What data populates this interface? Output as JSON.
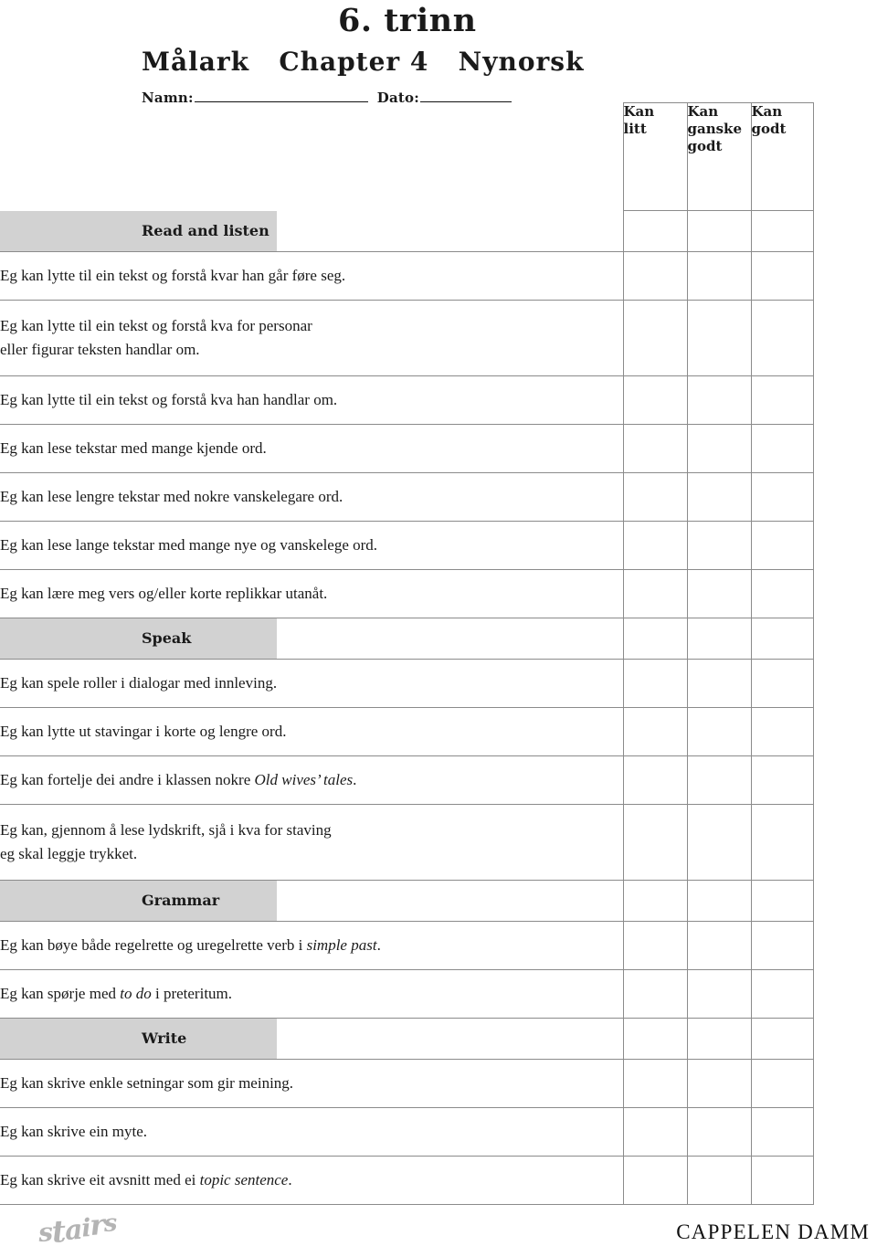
{
  "header": {
    "grade": "6. trinn",
    "title": "Målark   Chapter 4   Nynorsk",
    "name_label": "Namn:",
    "date_label": "Dato:"
  },
  "table": {
    "columns": [
      {
        "id": "statement",
        "label": ""
      },
      {
        "id": "kan_litt",
        "label": "Kan\nlitt"
      },
      {
        "id": "kan_ganske_godt",
        "label": "Kan\nganske\ngodt"
      },
      {
        "id": "kan_godt",
        "label": "Kan\ngodt"
      }
    ],
    "column_labels": {
      "kan_litt_line1": "Kan",
      "kan_litt_line2": "litt",
      "kan_ganske_godt_line1": "Kan",
      "kan_ganske_godt_line2": "ganske",
      "kan_ganske_godt_line3": "godt",
      "kan_godt_line1": "Kan",
      "kan_godt_line2": "godt"
    },
    "sections": [
      {
        "heading": "Read and listen",
        "items": [
          {
            "lines": [
              "Eg kan lytte til ein tekst og forstå kvar han går føre seg."
            ]
          },
          {
            "lines": [
              "Eg kan lytte til ein tekst og forstå kva for personar",
              "eller figurar teksten handlar om."
            ]
          },
          {
            "lines": [
              "Eg kan lytte til ein tekst og forstå kva han handlar om."
            ]
          },
          {
            "lines": [
              "Eg kan lese tekstar med mange kjende ord."
            ]
          },
          {
            "lines": [
              "Eg kan lese lengre tekstar med nokre vanskelegare ord."
            ]
          },
          {
            "lines": [
              "Eg kan lese lange tekstar med mange nye og vanskelege ord."
            ]
          },
          {
            "lines": [
              "Eg kan lære meg vers og/eller korte replikkar utanåt."
            ]
          }
        ]
      },
      {
        "heading": "Speak",
        "items": [
          {
            "lines": [
              "Eg kan spele roller i dialogar med innleving."
            ]
          },
          {
            "lines": [
              "Eg kan lytte ut stavingar i korte og lengre ord."
            ]
          },
          {
            "pre": "Eg kan fortelje dei andre i klassen nokre ",
            "italic": "Old wives’ tales",
            "post": "."
          },
          {
            "lines": [
              "Eg kan, gjennom å lese lydskrift, sjå i kva for staving",
              "eg skal leggje trykket."
            ]
          }
        ]
      },
      {
        "heading": "Grammar",
        "items": [
          {
            "pre": "Eg kan bøye både regelrette og uregelrette verb i ",
            "italic": "simple past",
            "post": "."
          },
          {
            "pre": "Eg kan spørje med ",
            "italic": "to do",
            "post": " i preteritum."
          }
        ]
      },
      {
        "heading": "Write",
        "items": [
          {
            "lines": [
              "Eg kan skrive enkle setningar som gir meining."
            ]
          },
          {
            "lines": [
              "Eg kan skrive ein myte."
            ]
          },
          {
            "pre": "Eg kan skrive eit avsnitt med ei ",
            "italic": "topic sentence",
            "post": "."
          }
        ]
      }
    ]
  },
  "footer": {
    "logo_stairs": "stairs",
    "publisher": "CAPPELEN DAMM"
  },
  "colors": {
    "band_gray": "#d2d2d2",
    "grid_line": "#8b8b8b",
    "text": "#1a1a1a",
    "logo_gray": "#b4b4b4"
  }
}
